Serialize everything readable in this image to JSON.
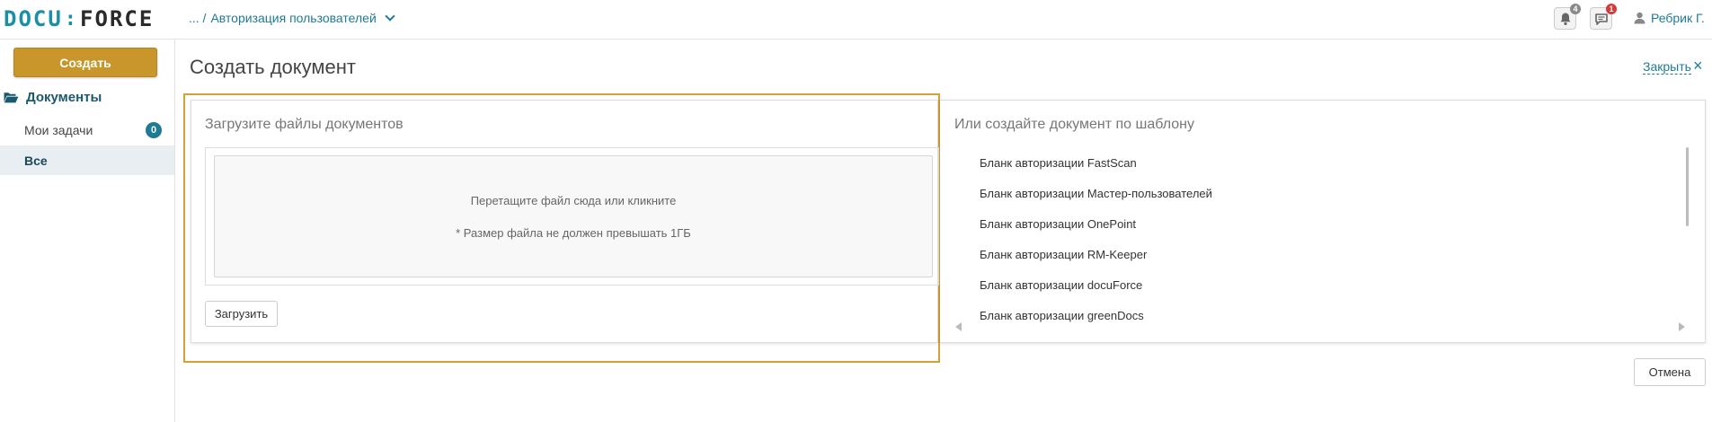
{
  "header": {
    "logo_left": "DOCU",
    "logo_sep": ":",
    "logo_right": "FORCE",
    "breadcrumb_prefix": "... /",
    "breadcrumb_current": "Авторизация пользователей",
    "notifications_count": "4",
    "messages_count": "1",
    "user_name": "Ребрик Г."
  },
  "sidebar": {
    "create_label": "Создать",
    "section_label": "Документы",
    "items": [
      {
        "label": "Мои задачи",
        "count": "0"
      },
      {
        "label": "Все"
      }
    ]
  },
  "main": {
    "title": "Создать документ",
    "close_label": "Закрыть",
    "close_icon": "×",
    "upload": {
      "heading": "Загрузите файлы документов",
      "drop_text": "Перетащите файл сюда или кликните",
      "size_note": "* Размер файла не должен превышать 1ГБ",
      "button_label": "Загрузить"
    },
    "templates": {
      "heading": "Или создайте документ по шаблону",
      "items": [
        "Бланк авторизации FastScan",
        "Бланк авторизации Мастер-пользователей",
        "Бланк авторизации OnePoint",
        "Бланк авторизации RM-Keeper",
        "Бланк авторизации docuForce",
        "Бланк авторизации greenDocs"
      ]
    },
    "cancel_label": "Отмена"
  },
  "colors": {
    "accent": "#1f7b94",
    "create_button": "#c9962b",
    "highlight": "#d4a23a",
    "badge_red": "#d33a3a"
  },
  "icons": [
    "bell-icon",
    "chat-icon",
    "user-icon",
    "folder-open-icon",
    "close-icon",
    "chevron-down-icon"
  ]
}
